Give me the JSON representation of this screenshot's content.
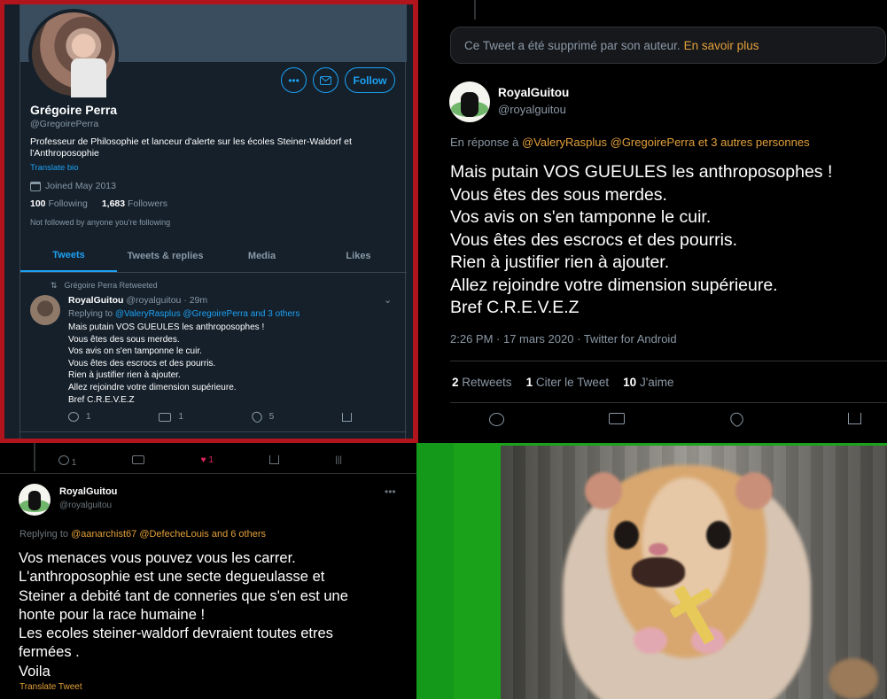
{
  "profile": {
    "name": "Grégoire Perra",
    "handle": "@GregoirePerra",
    "bio": "Professeur de Philosophie et lanceur d'alerte sur les écoles Steiner-Waldorf et l'Anthroposophie",
    "translate_bio": "Translate bio",
    "joined": "Joined May 2013",
    "following_count": "100",
    "following_label": "Following",
    "followers_count": "1,683",
    "followers_label": "Followers",
    "not_followed": "Not followed by anyone you’re following",
    "follow_label": "Follow",
    "more_icon": "•••",
    "tabs": [
      {
        "label": "Tweets"
      },
      {
        "label": "Tweets & replies"
      },
      {
        "label": "Media"
      },
      {
        "label": "Likes"
      }
    ],
    "retweeted_by": "Grégoire Perra Retweeted",
    "tweet": {
      "author": "RoyalGuitou",
      "handle_time": "@royalguitou · 29m",
      "replying_prefix": "Replying to",
      "replying_mentions": "@ValeryRasplus @GregoirePerra",
      "replying_suffix": "and 3 others",
      "body": "Mais putain VOS GUEULES  les anthroposophes !\nVous êtes des sous merdes.\nVos avis on s'en tamponne le cuir.\nVous êtes des escrocs et des pourris.\nRien à justifier rien à ajouter.\nAllez rejoindre votre dimension supérieure.\nBref C.R.E.V.E.Z",
      "replies": "1",
      "retweets": "1",
      "likes": "5"
    }
  },
  "detail": {
    "deleted_notice": "Ce Tweet a été supprimé par son auteur.",
    "learn_more": "En savoir plus",
    "author": "RoyalGuitou",
    "handle": "@royalguitou",
    "reply_prefix": "En réponse à",
    "reply_mentions": "@ValeryRasplus @GregoirePerra",
    "reply_suffix": "et 3 autres personnes",
    "body": "Mais putain VOS GUEULES  les anthroposophes !\nVous êtes des sous merdes.\nVos avis on s'en tamponne le cuir.\nVous êtes des escrocs et des pourris.\nRien à justifier rien à ajouter.\nAllez rejoindre votre dimension supérieure.\nBref C.R.E.V.E.Z",
    "meta": "2:26 PM · 17 mars 2020 · Twitter for Android",
    "retweets_count": "2",
    "retweets_label": "Retweets",
    "quote_count": "1",
    "quote_label": "Citer le Tweet",
    "likes_count": "10",
    "likes_label": "J'aime"
  },
  "second": {
    "top_replies": "1",
    "top_likes": "1",
    "author": "RoyalGuitou",
    "handle": "@royalguitou",
    "replying_prefix": "Replying to",
    "replying_mentions": "@aanarchist67 @DefecheLouis",
    "replying_suffix": "and 6 others",
    "body": "Vos menaces vous pouvez vous les carrer.\nL'anthroposophie est une secte degueulasse et\nSteiner a debité tant de conneries que s'en est une\nhonte pour la race humaine !\nLes ecoles steiner-waldorf devraient toutes etres\nfermées .\nVoila",
    "translate": "Translate Tweet"
  },
  "colors": {
    "accent_blue": "#1da1f2",
    "accent_orange": "#e3a03a",
    "frame_red": "#b0141c",
    "meme_green": "#1aa31a"
  },
  "icons": [
    "more-icon",
    "mail-icon",
    "calendar-icon",
    "retweet-icon",
    "reply-icon",
    "heart-icon",
    "share-icon",
    "chevron-down-icon",
    "stats-icon"
  ]
}
